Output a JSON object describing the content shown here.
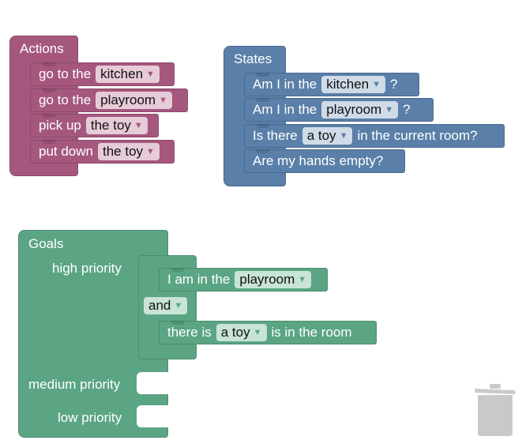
{
  "actions": {
    "title": "Actions",
    "items": [
      {
        "prefix": "go to the",
        "value": "kitchen",
        "suffix": ""
      },
      {
        "prefix": "go to the",
        "value": "playroom",
        "suffix": ""
      },
      {
        "prefix": "pick up",
        "value": "the toy",
        "suffix": ""
      },
      {
        "prefix": "put down",
        "value": "the toy",
        "suffix": ""
      }
    ]
  },
  "states": {
    "title": "States",
    "items": [
      {
        "prefix": "Am I in the",
        "value": "kitchen",
        "suffix": "?"
      },
      {
        "prefix": "Am I in the",
        "value": "playroom",
        "suffix": "?"
      },
      {
        "prefix": "Is there",
        "value": "a toy",
        "suffix": "in the current room?"
      },
      {
        "prefix": "Are my hands empty?",
        "value": "",
        "suffix": ""
      }
    ]
  },
  "goals": {
    "title": "Goals",
    "high_label": "high priority",
    "medium_label": "medium priority",
    "low_label": "low priority",
    "cond1": {
      "prefix": "I am in the",
      "value": "playroom"
    },
    "op": "and",
    "cond2": {
      "prefix": "there is",
      "value": "a toy",
      "suffix": "is in the room"
    }
  },
  "dropdown_arrow": "▼",
  "colors": {
    "actions": "#a5577e",
    "states": "#5a7fa8",
    "goals": "#5ba584",
    "trash": "#c9c9c9"
  }
}
